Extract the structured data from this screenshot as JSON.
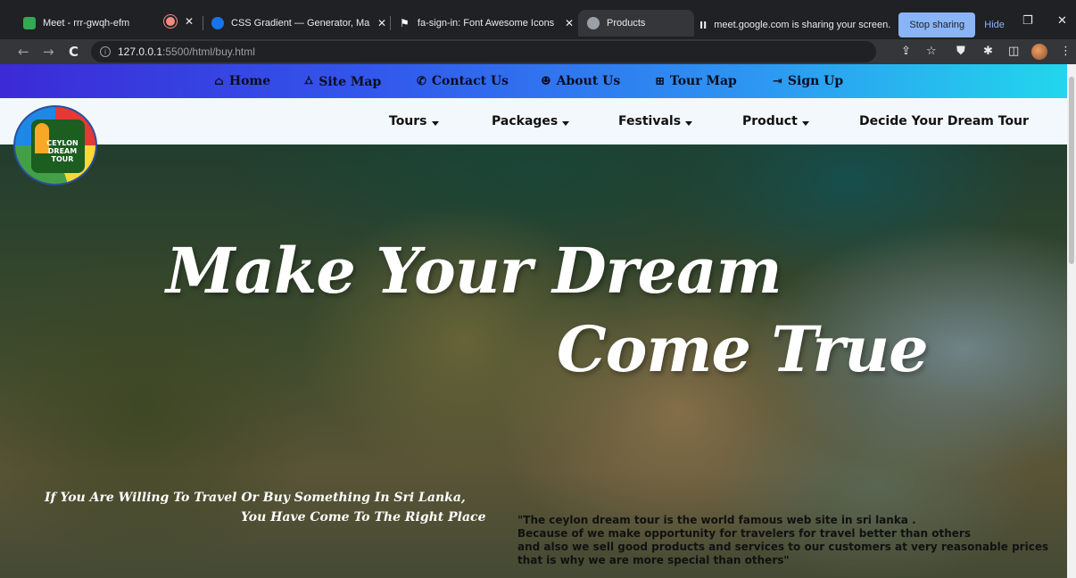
{
  "browser": {
    "tabs": [
      {
        "title": "Meet - rrr-gwqh-efm",
        "favicon_color": "#34a853"
      },
      {
        "title": "CSS Gradient — Generator, Make",
        "favicon_color": "#1a73e8"
      },
      {
        "title": "fa-sign-in: Font Awesome Icons",
        "favicon_color": "#ffffff"
      },
      {
        "title": "Products",
        "favicon_color": "#9aa0a6"
      }
    ],
    "close_glyph": "✕",
    "screen_share": {
      "pause_glyph": "II",
      "message": "meet.google.com is sharing your screen.",
      "stop_label": "Stop sharing",
      "hide_label": "Hide"
    },
    "window_controls": {
      "restore": "❐",
      "close": "✕"
    },
    "nav": {
      "back": "←",
      "forward": "→",
      "reload": "C"
    },
    "address": {
      "info": "i",
      "host": "127.0.0.1",
      "path": ":5500/html/buy.html"
    },
    "toolbar_icons": {
      "share": "⇪",
      "bookmark": "☆",
      "shield": "⛊",
      "extensions": "✱",
      "sidepanel": "◫",
      "menu": "⋮"
    }
  },
  "site": {
    "top_links": [
      {
        "icon": "⌂",
        "label": "Home"
      },
      {
        "icon": "⛼",
        "label": "Site Map"
      },
      {
        "icon": "✆",
        "label": "Contact Us"
      },
      {
        "icon": "☻",
        "label": "About Us"
      },
      {
        "icon": "⊞",
        "label": "Tour Map"
      },
      {
        "icon": "⇥",
        "label": "Sign Up"
      }
    ],
    "main_menu": [
      {
        "label": "Tours"
      },
      {
        "label": "Packages"
      },
      {
        "label": "Festivals"
      },
      {
        "label": "Product"
      },
      {
        "label": "Decide Your Dream Tour"
      }
    ],
    "logo_text": "CEYLON DREAM TOUR",
    "hero": {
      "line1": "Make Your Dream",
      "line2": "Come True",
      "tagline1": "If You Are Willing To Travel Or Buy Something In Sri Lanka,",
      "tagline2": "You Have Come To The Right Place",
      "quote_lines": [
        "\"The ceylon dream tour is the world famous web site in sri lanka .",
        "Because of we make opportunity for travelers for travel better than others",
        "and also we sell good products and services to our customers at very reasonable prices",
        "that is why we are more special than others\""
      ]
    }
  }
}
